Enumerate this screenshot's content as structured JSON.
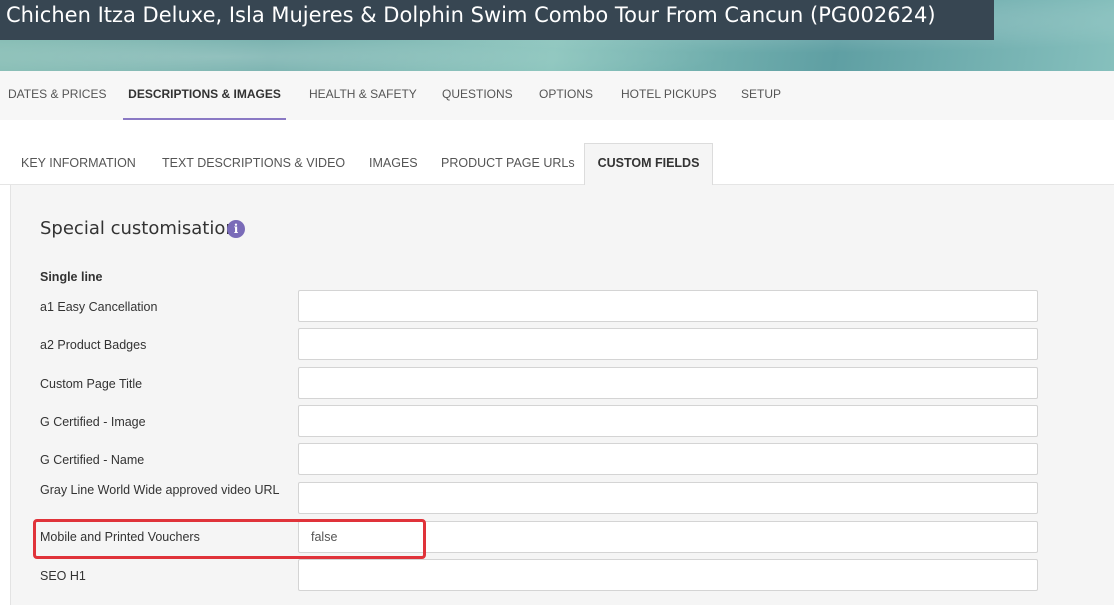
{
  "header": {
    "title": "Chichen Itza Deluxe, Isla Mujeres & Dolphin Swim Combo Tour From Cancun (PG002624)"
  },
  "main_tabs": [
    {
      "label": "DATES & PRICES"
    },
    {
      "label": "DESCRIPTIONS & IMAGES",
      "active": true
    },
    {
      "label": "HEALTH & SAFETY"
    },
    {
      "label": "QUESTIONS"
    },
    {
      "label": "OPTIONS"
    },
    {
      "label": "HOTEL PICKUPS"
    },
    {
      "label": "SETUP"
    }
  ],
  "sub_tabs": [
    {
      "label": "KEY INFORMATION"
    },
    {
      "label": "TEXT DESCRIPTIONS & VIDEO"
    },
    {
      "label": "IMAGES"
    },
    {
      "label": "PRODUCT PAGE URLs"
    },
    {
      "label": "CUSTOM FIELDS",
      "active": true
    }
  ],
  "section": {
    "title": "Special customisation",
    "info_icon": "info-icon",
    "group_label": "Single line"
  },
  "fields": [
    {
      "label": "a1 Easy Cancellation",
      "value": ""
    },
    {
      "label": "a2 Product Badges",
      "value": ""
    },
    {
      "label": "Custom Page Title",
      "value": ""
    },
    {
      "label": "G Certified - Image",
      "value": ""
    },
    {
      "label": "G Certified - Name",
      "value": ""
    },
    {
      "label": "Gray Line World Wide approved video URL",
      "value": ""
    },
    {
      "label": "Mobile and Printed Vouchers",
      "value": "false"
    },
    {
      "label": "SEO H1",
      "value": ""
    }
  ],
  "colors": {
    "accent": "#8a79c4",
    "header_bg": "#374652",
    "highlight": "#e0333a"
  }
}
